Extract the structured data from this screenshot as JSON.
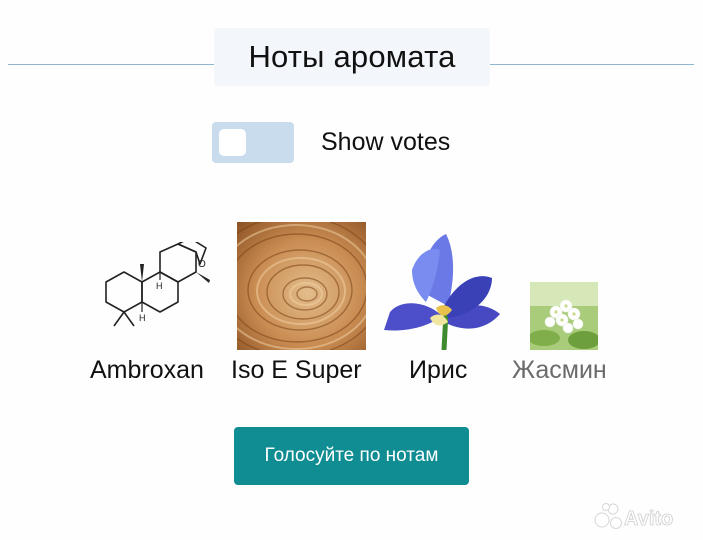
{
  "header": {
    "title": "Ноты аромата"
  },
  "votes_toggle": {
    "label": "Show votes",
    "on": false
  },
  "notes": [
    {
      "label": "Ambroxan",
      "image_kind": "molecule-structure"
    },
    {
      "label": "Iso E Super",
      "image_kind": "wood-texture"
    },
    {
      "label": "Ирис",
      "image_kind": "iris-flower"
    },
    {
      "label": "Жасмин",
      "image_kind": "jasmine-flower"
    }
  ],
  "vote_button": {
    "label": "Голосуйте по нотам"
  },
  "watermark": {
    "text": "Avito"
  },
  "colors": {
    "accent": "#0f8d93",
    "toggle_bg": "#c9dcee",
    "title_bg": "#f3f7fb",
    "rule": "#8fb6cf"
  }
}
